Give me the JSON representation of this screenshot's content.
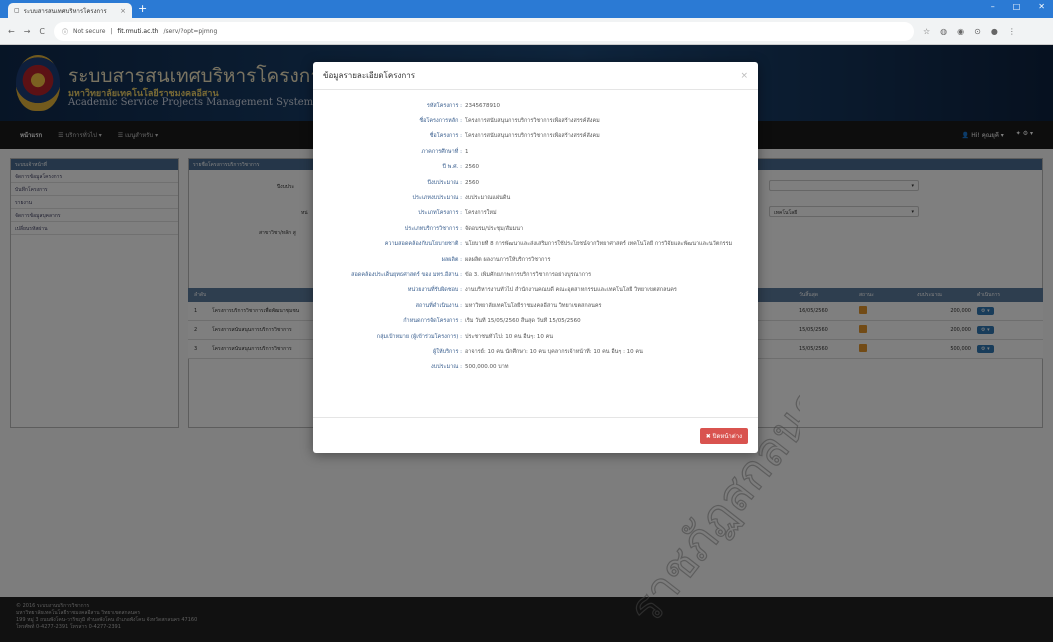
{
  "browser": {
    "tab_title": "ระบบสารสนเทศบริหารโครงการ",
    "url_secure": "Not secure",
    "url_host": "fit.rmuti.ac.th",
    "url_path": "/serv/?opt=pjmng"
  },
  "banner": {
    "title": "ระบบสารสนเทศบริหารโครงการบริการวิชาการ",
    "subtitle": "มหาวิทยาลัยเทคโนโลยีราชมงคลอีสาน",
    "english": "Academic Service Projects Management System: RMUTI"
  },
  "navbar": {
    "home": "หน้าแรก",
    "menu1": "บริการทั่วไป",
    "menu2": "เมนูสำหรับ",
    "user": "Hi! คุณยุคี"
  },
  "sidebar": {
    "header": "ระบบเจ้าหน้าที่",
    "items": [
      {
        "label": "จัดการข้อมูลโครงการ"
      },
      {
        "label": "บันทึกโครงการ"
      },
      {
        "label": "รายงาน"
      },
      {
        "label": "จัดการข้อมูลบุคลากร"
      },
      {
        "label": "เปลี่ยนรหัสผ่าน"
      }
    ]
  },
  "panel": {
    "header": "รายชื่อโครงการบริการวิชาการ",
    "f1_label": "ปีงบประ",
    "f2_label": "หน่",
    "f3_label": "สาขาวิชา/หลัก สู",
    "select2_value": "เทคโนโลยี"
  },
  "table": {
    "headers": {
      "no": "ลำดับ",
      "name": "",
      "start": "เริ่ม",
      "end": "วันสิ้นสุด",
      "status": "สถานะ",
      "budget": "งบประมาณ",
      "action": "ดำเนินการ"
    },
    "rows": [
      {
        "no": "1",
        "name": "โครงการบริการวิชาการเพื่อพัฒนาชุมชน",
        "start": "2560",
        "end": "16/05/2560",
        "budget": "200,000"
      },
      {
        "no": "2",
        "name": "โครงการสนับสนุนการบริการวิชาการ",
        "start": "2560",
        "end": "15/05/2560",
        "budget": "200,000"
      },
      {
        "no": "3",
        "name": "โครงการสนับสนุนการบริการวิชาการ",
        "start": "2560",
        "end": "15/05/2560",
        "budget": "500,000"
      }
    ]
  },
  "footer": {
    "line1": "© 2016 ระบบงานบริการวิชาการ",
    "line2": "มหาวิทยาลัยเทคโนโลยีราชมงคลอีสาน วิทยาเขตสกลนคร",
    "line3": "199 หมู่ 3 ถนนพังโคน-วาริชภูมิ ตำบลพังโคน อำเภอพังโคน จังหวัดสกลนคร 47160",
    "line4": "โทรศัพท์ 0-4277-2391 โทรสาร 0-4277-2391"
  },
  "modal": {
    "title": "ข้อมูลรายละเอียดโครงการ",
    "close_x": "×",
    "close_button": "ปิดหน้าต่าง",
    "rows": [
      {
        "label": "รหัสโครงการ :",
        "value": "2345678910"
      },
      {
        "label": "ชื่อโครงการหลัก :",
        "value": "โครงการสนับสนุนการบริการวิชาการเพื่อสร้างสรรค์สังคม"
      },
      {
        "label": "ชื่อโครงการ :",
        "value": "โครงการสนับสนุนการบริการวิชาการเพื่อสร้างสรรค์สังคม"
      },
      {
        "label": "ภาคการศึกษาที่ :",
        "value": "1"
      },
      {
        "label": "ปี พ.ศ. :",
        "value": "2560"
      },
      {
        "label": "ปีงบประมาณ :",
        "value": "2560"
      },
      {
        "label": "ประเภทงบประมาณ :",
        "value": "งบประมาณแผ่นดิน"
      },
      {
        "label": "ประเภทโครงการ :",
        "value": "โครงการใหม่"
      },
      {
        "label": "ประเภทบริการวิชาการ :",
        "value": "จัดอบรม/ประชุม/สัมมนา"
      },
      {
        "label": "ความสอดคล้องกับนโยบายชาติ :",
        "value": "นโยบายที่ 8 การพัฒนาและส่งเสริมการใช้ประโยชน์จากวิทยาศาสตร์ เทคโนโลยี การวิจัยและพัฒนาและนวัตกรรม"
      },
      {
        "label": "ผลผลิต :",
        "value": "ผลผลิต ผลงานการให้บริการวิชาการ"
      },
      {
        "label": "สอดคล้องประเด็นยุทธศาสตร์ ของ มทร.อีสาน :",
        "value": "ข้อ 3. เพิ่มศักยภาพการบริการวิชาการอย่างบูรณาการ"
      },
      {
        "label": "หน่วยงานที่รับผิดชอบ :",
        "value": "งานบริหารงานทั่วไป สำนักงานคณบดี คณะอุตสาหกรรมและเทคโนโลยี วิทยาเขตสกลนคร"
      },
      {
        "label": "สถานที่ดำเนินงาน :",
        "value": "มหาวิทยาลัยเทคโนโลยีราชมงคลอีสาน วิทยาเขตสกลนคร"
      },
      {
        "label": "กำหนดการจัดโครงการ :",
        "value": "เริ่ม วันที่ 15/05/2560 สิ้นสุด วันที่ 15/05/2560"
      },
      {
        "label": "กลุ่มเป้าหมาย (ผู้เข้าร่วมโครงการ) :",
        "value": "ประชาชนทั่วไป: 10 คน อื่นๆ: 10 คน"
      },
      {
        "label": "ผู้ให้บริการ :",
        "value": "อาจารย์: 10 คน นักศึกษา: 10 คน บุคลากรเจ้าหน้าที่: 10 คน อื่นๆ : 10 คน"
      },
      {
        "label": "งบประมาณ :",
        "value": "500,000.00 บาท"
      }
    ]
  },
  "watermark": {
    "text": "ราชภัฏสกลนคร",
    "color": "#444444"
  }
}
